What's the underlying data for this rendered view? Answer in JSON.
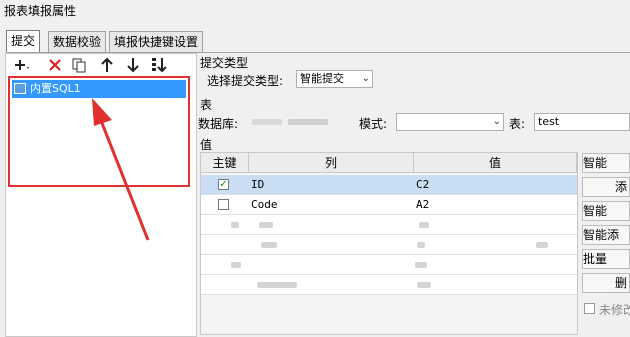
{
  "window": {
    "title": "报表填报属性"
  },
  "tabs": [
    {
      "label": "提交"
    },
    {
      "label": "数据校验"
    },
    {
      "label": "填报快捷键设置"
    }
  ],
  "toolbar": {
    "icons": [
      "add-icon",
      "delete-icon",
      "copy-icon",
      "move-up-icon",
      "move-down-icon",
      "sort-icon"
    ]
  },
  "tree": {
    "items": [
      {
        "label": "内置SQL1",
        "icon": "sql-table-icon"
      }
    ]
  },
  "submit": {
    "section_label": "提交类型",
    "type_label": "选择提交类型:",
    "type_value": "智能提交"
  },
  "table_section": {
    "section_label": "表",
    "db_label": "数据库:",
    "schema_label": "模式:",
    "schema_value": "",
    "table_label": "表:",
    "table_value": "test"
  },
  "value_section": {
    "section_label": "值",
    "columns": [
      "主键",
      "列",
      "值"
    ],
    "rows": [
      {
        "key": true,
        "col": "ID",
        "val": "C2"
      },
      {
        "key": false,
        "col": "Code",
        "val": "A2"
      }
    ]
  },
  "side_buttons": [
    "智能",
    "添",
    "智能",
    "智能添",
    "批量",
    "删"
  ],
  "footer": {
    "unmodified_label": "未修改"
  },
  "colors": {
    "selection": "#3399ff",
    "annotation": "#e03030",
    "row_selected": "#c9def5"
  }
}
